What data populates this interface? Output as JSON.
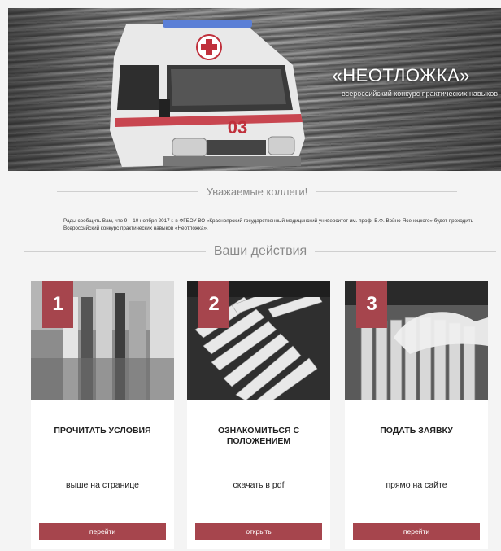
{
  "hero": {
    "title": "«НЕОТЛОЖКА»",
    "subtitle": "всероссийский конкурс практических навыков",
    "ambulance_number": "03"
  },
  "greeting": {
    "heading": "Уважаемые коллеги!",
    "text": "Рады сообщить Вам, что 9 – 10 ноября 2017 г. в ФГБОУ ВО «Красноярский государственный медицинский университет им. проф. В.Ф. Войно-Ясенецкого» будет проходить Всероссийский конкурс практических навыков «Неотложка»."
  },
  "actions": {
    "heading": "Ваши действия",
    "cards": [
      {
        "number": "1",
        "title": "ПРОЧИТАТЬ УСЛОВИЯ",
        "description": "выше на странице",
        "button": "перейти"
      },
      {
        "number": "2",
        "title": "ОЗНАКОМИТЬСЯ С ПОЛОЖЕНИЕМ",
        "description": "скачать в pdf",
        "button": "открыть"
      },
      {
        "number": "3",
        "title": "ПОДАТЬ ЗАЯВКУ",
        "description": "прямо на сайте",
        "button": "перейти"
      }
    ]
  },
  "colors": {
    "accent": "#a6454d",
    "background": "#f4f4f4",
    "card": "#ffffff",
    "heading_text": "#8a8a8a"
  }
}
